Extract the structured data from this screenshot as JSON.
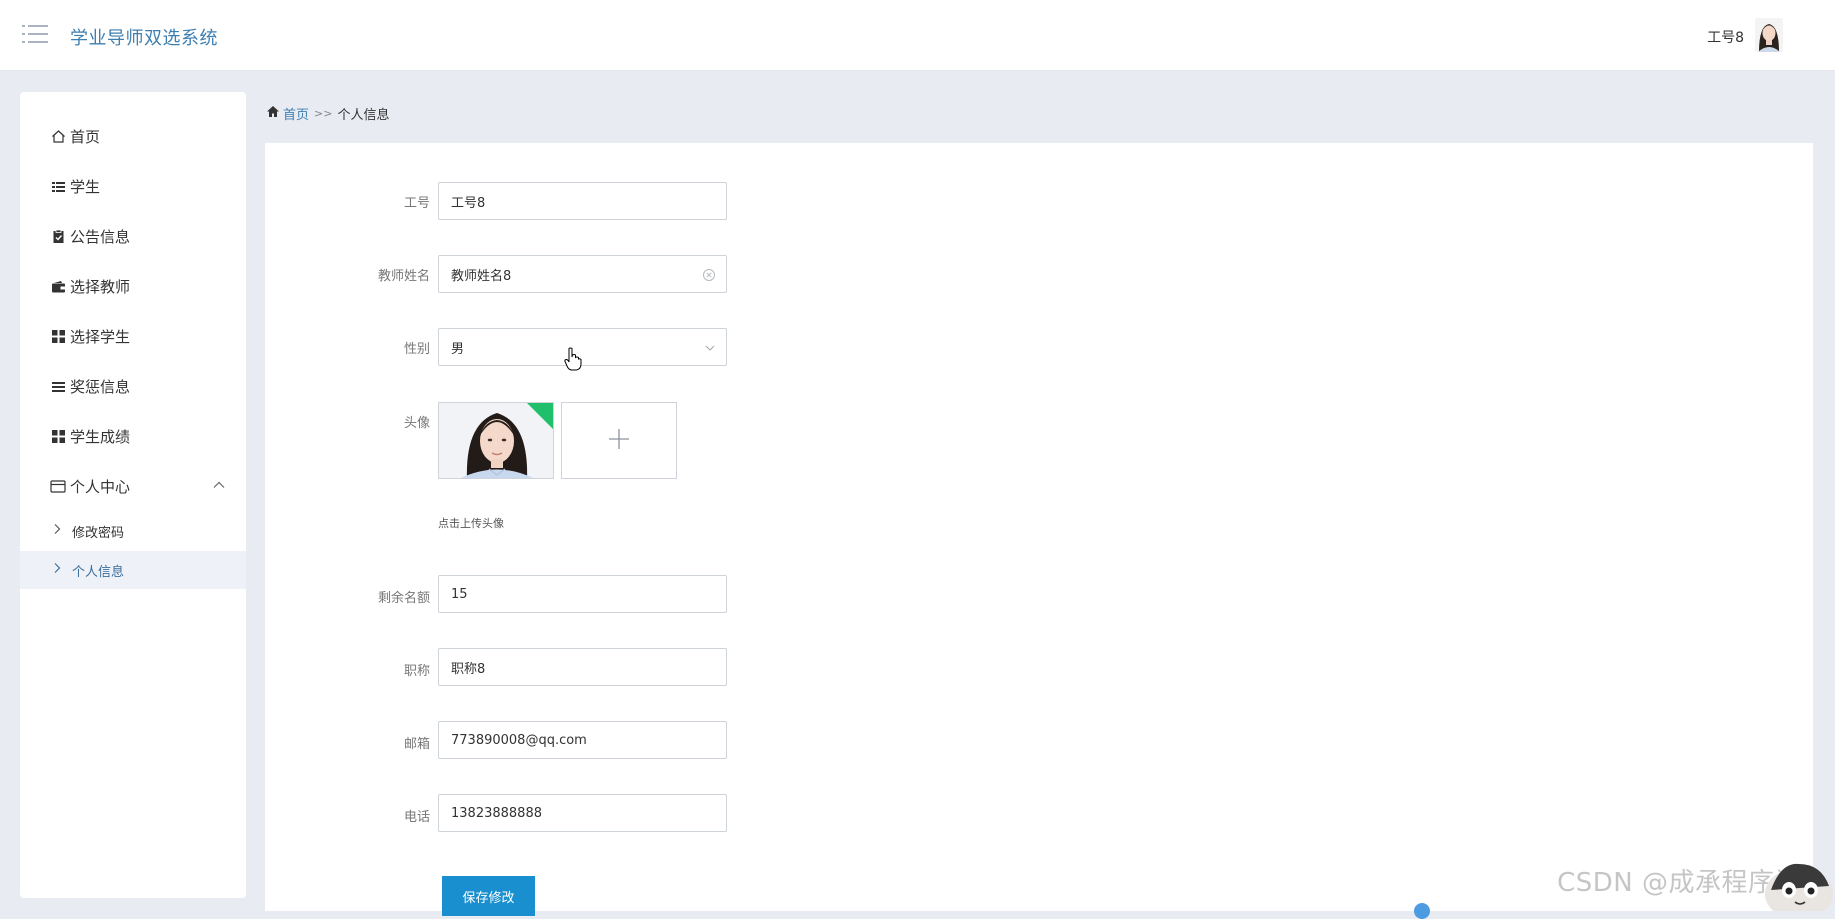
{
  "header": {
    "app_title": "学业导师双选系统",
    "user_name": "工号8"
  },
  "sidebar": {
    "items": [
      {
        "label": "首页",
        "icon": "home-icon"
      },
      {
        "label": "学生",
        "icon": "list-icon"
      },
      {
        "label": "公告信息",
        "icon": "clipboard-icon"
      },
      {
        "label": "选择教师",
        "icon": "wallet-icon"
      },
      {
        "label": "选择学生",
        "icon": "grid-icon"
      },
      {
        "label": "奖惩信息",
        "icon": "lines-icon"
      },
      {
        "label": "学生成绩",
        "icon": "grid-icon"
      },
      {
        "label": "个人中心",
        "icon": "card-icon"
      }
    ],
    "sub_items": [
      {
        "label": "修改密码"
      },
      {
        "label": "个人信息"
      }
    ]
  },
  "breadcrumb": {
    "home": "首页",
    "separator": ">>",
    "current": "个人信息"
  },
  "form": {
    "employee_id": {
      "label": "工号",
      "value": "工号8"
    },
    "teacher_name": {
      "label": "教师姓名",
      "value": "教师姓名8"
    },
    "gender": {
      "label": "性别",
      "value": "男"
    },
    "avatar": {
      "label": "头像",
      "hint": "点击上传头像"
    },
    "remaining_quota": {
      "label": "剩余名额",
      "value": "15"
    },
    "title": {
      "label": "职称",
      "value": "职称8"
    },
    "email": {
      "label": "邮箱",
      "value": "773890008@qq.com"
    },
    "phone": {
      "label": "电话",
      "value": "13823888888"
    },
    "save_label": "保存修改"
  },
  "watermark": "CSDN @成承程序设",
  "colors": {
    "accent": "#3e7fb1",
    "button": "#1a8fd0",
    "success": "#1fbf6b",
    "background": "#e8ebf2"
  }
}
